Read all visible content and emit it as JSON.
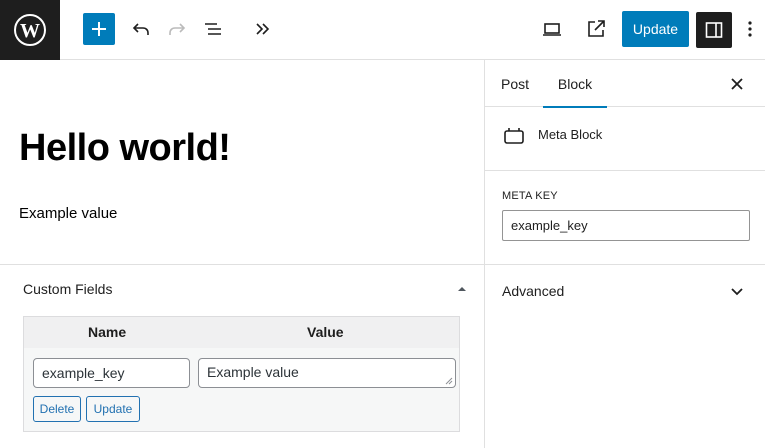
{
  "toolbar": {
    "logo_icon": "wordpress-logo-icon",
    "add_icon": "plus-icon",
    "undo_icon": "undo-icon",
    "redo_icon": "redo-icon",
    "list_view_icon": "list-view-icon",
    "more_tools_icon": "double-chevron-right-icon",
    "preview_icon": "laptop-icon",
    "view_post_icon": "external-link-icon",
    "update_label": "Update",
    "settings_icon": "sidebar-icon",
    "options_icon": "vertical-ellipsis-icon",
    "accent_color": "#007cba"
  },
  "editor": {
    "title": "Hello world!",
    "paragraph": "Example value"
  },
  "metabox": {
    "title": "Custom Fields",
    "toggle_icon": "triangle-up-icon",
    "columns": [
      "Name",
      "Value"
    ],
    "row": {
      "key": "example_key",
      "value": "Example value",
      "delete_label": "Delete",
      "update_label": "Update"
    }
  },
  "sidebar": {
    "tabs": [
      {
        "label": "Post",
        "active": false
      },
      {
        "label": "Block",
        "active": true
      }
    ],
    "close_icon": "close-icon",
    "block_card": {
      "icon": "meta-block-icon",
      "title": "Meta Block"
    },
    "meta_key": {
      "label": "META KEY",
      "value": "example_key"
    },
    "advanced": {
      "label": "Advanced",
      "icon": "chevron-down-icon"
    }
  }
}
